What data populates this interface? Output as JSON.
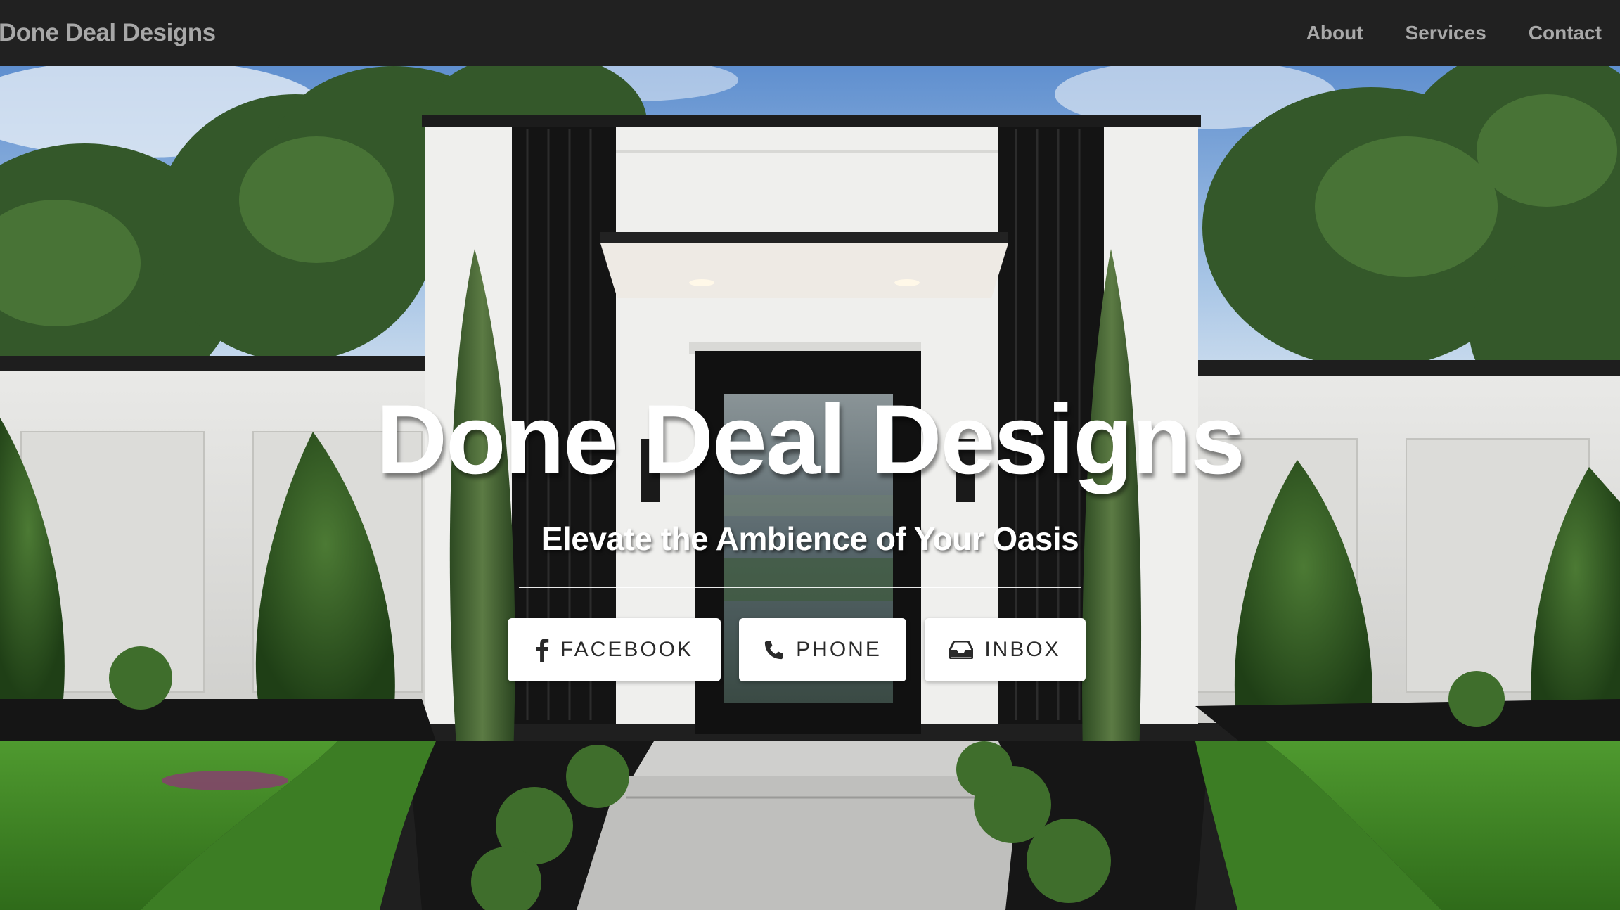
{
  "navbar": {
    "brand": "Done Deal Designs",
    "links": [
      {
        "label": "About"
      },
      {
        "label": "Services"
      },
      {
        "label": "Contact"
      }
    ]
  },
  "hero": {
    "title": "Done Deal Designs",
    "subtitle": "Elevate the Ambience of Your Oasis",
    "buttons": [
      {
        "label": "FACEBOOK",
        "icon": "facebook-icon"
      },
      {
        "label": "PHONE",
        "icon": "phone-icon"
      },
      {
        "label": "INBOX",
        "icon": "inbox-icon"
      }
    ],
    "background_image": "modern white house entrance with black door, cypress trees and lawn"
  },
  "colors": {
    "navbar_bg": "#212121",
    "nav_text": "#a8a8a8",
    "button_bg": "#ffffff",
    "button_text": "#2a2a2a"
  }
}
